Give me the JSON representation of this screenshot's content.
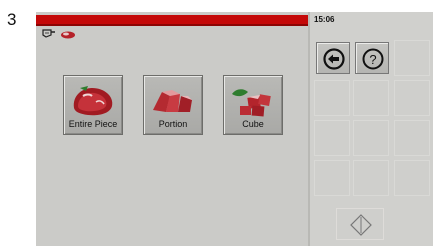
{
  "step_number": "3",
  "status_bar": {
    "time": "15:06"
  },
  "icons": {
    "settings": "cleaver-icon",
    "product": "meat-icon",
    "back": "back-arrow-icon",
    "help": "help-icon",
    "start": "diamond-arrows-icon"
  },
  "help_label": "?",
  "products": [
    {
      "label": "Entire Piece"
    },
    {
      "label": "Portion"
    },
    {
      "label": "Cube"
    }
  ],
  "colors": {
    "header_red": "#c40808",
    "panel_gray": "#cbcbc8",
    "button_gray": "#b5b5b2"
  }
}
